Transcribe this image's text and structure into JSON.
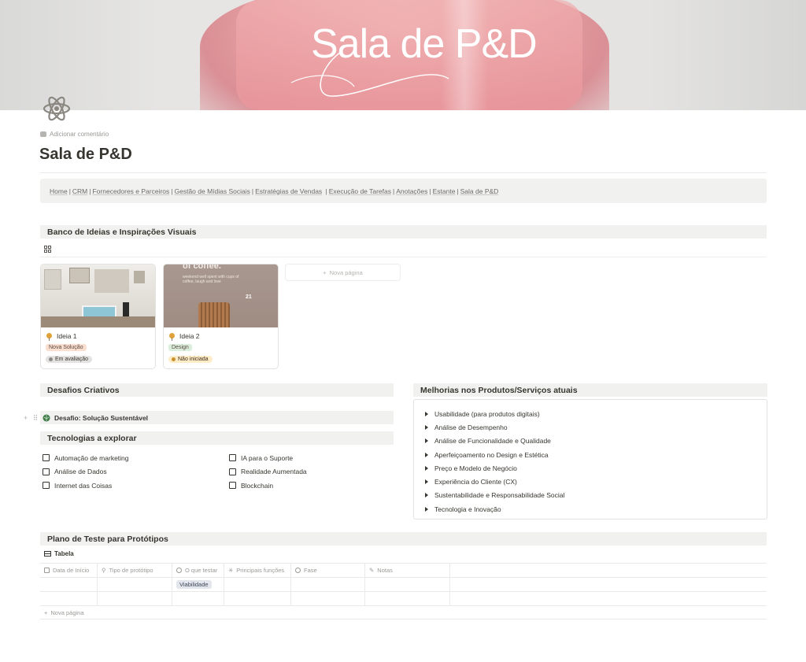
{
  "cover": {
    "title": "Sala de P&D"
  },
  "page": {
    "icon": "atom-icon",
    "add_comment": "Adicionar comentário",
    "title": "Sala de P&D"
  },
  "breadcrumb": [
    "Home",
    "CRM",
    "Fornecedores e Parceiros",
    "Gestão de Mídias Sociais",
    "Estratégias de Vendas",
    "Execução de Tarefas",
    "Anotações",
    "Estante",
    "Sala de P&D"
  ],
  "ideas": {
    "header": "Banco de Ideias e Inspirações Visuais",
    "view_icon": "gallery-icon",
    "cards": [
      {
        "name": "Ideia 1",
        "tag": "Nova Solução",
        "status": "Em avaliação"
      },
      {
        "name": "Ideia 2",
        "tag": "Design",
        "status": "Não iniciada",
        "image_text": {
          "headline": "of coffee.",
          "sub": "weekend well spent with cups of coffee, laugh and love",
          "number": "21"
        }
      }
    ],
    "new_page": "Nova página"
  },
  "challenges": {
    "header": "Desafios Criativos",
    "toggle": "Desafio: Solução Sustentável"
  },
  "tech": {
    "header": "Tecnologias a explorar",
    "col1": [
      "Automação de marketing",
      "Análise de Dados",
      "Internet das Coisas"
    ],
    "col2": [
      "IA para o Suporte",
      "Realidade Aumentada",
      "Blockchain"
    ]
  },
  "improvements": {
    "header": "Melhorias nos Produtos/Serviços atuais",
    "items": [
      "Usabilidade (para produtos digitais)",
      "Análise de Desempenho",
      "Análise de Funcionalidade e Qualidade",
      "Aperfeiçoamento no Design e Estética",
      "Preço e Modelo de Negócio",
      "Experiência do Cliente (CX)",
      "Sustentabilidade e Responsabilidade Social",
      "Tecnologia e Inovação"
    ]
  },
  "plan": {
    "header": "Plano de Teste para Protótipos",
    "view_label": "Tabela",
    "columns": [
      "Data de Início",
      "Tipo de protótipo",
      "O que testar",
      "Principais funções",
      "Fase",
      "Notas"
    ],
    "rows": [
      [
        "",
        "",
        "Viabilidade",
        "",
        "",
        ""
      ],
      [
        "",
        "",
        "",
        "",
        "",
        ""
      ]
    ],
    "new_page": "Nova página"
  },
  "colors": {
    "accent_pink": "#eaa3a6",
    "tag_nova_solucao": "#fadecf",
    "tag_design": "#dbeddb",
    "status_em_avaliacao": "#e3e2e0",
    "status_nao_iniciada": "#fdecc8"
  }
}
